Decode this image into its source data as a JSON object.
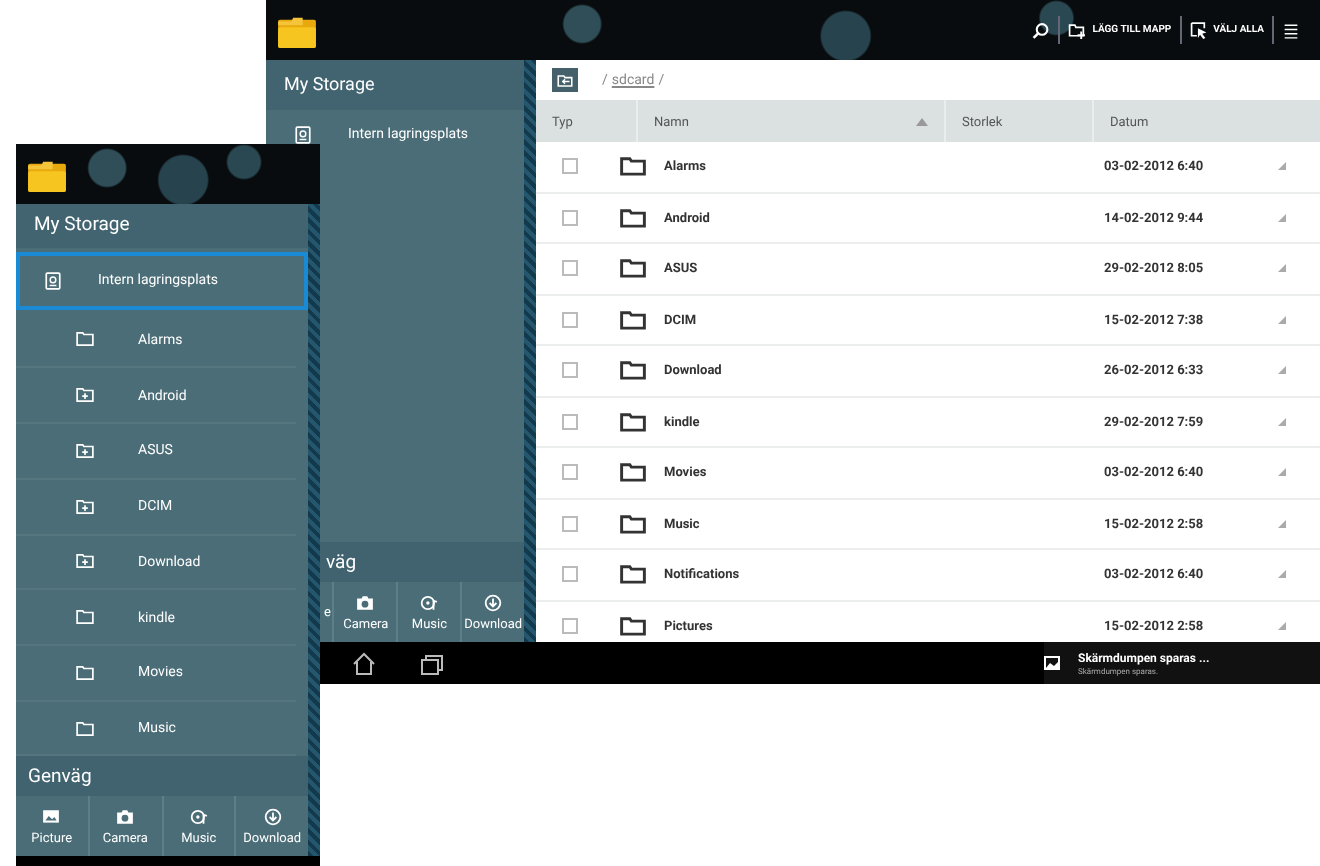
{
  "back_window": {
    "toolbar": {
      "actions": [
        {
          "kind": "search"
        },
        {
          "kind": "add_folder",
          "label": "LÄGG TILL MAPP"
        },
        {
          "kind": "select_all",
          "label": "VÄLJ ALLA"
        },
        {
          "kind": "menu"
        }
      ]
    },
    "sidebar": {
      "heading": "My Storage",
      "items": [
        {
          "label": "Intern lagringsplats",
          "selected": false
        }
      ],
      "shortcuts_heading": "väg",
      "shortcuts": [
        {
          "kind": "picture",
          "label": "e"
        },
        {
          "kind": "camera",
          "label": "Camera"
        },
        {
          "kind": "music",
          "label": "Music"
        },
        {
          "kind": "download",
          "label": "Download"
        }
      ]
    },
    "path": {
      "root": "/",
      "folder": "sdcard",
      "separator": "/"
    },
    "table": {
      "columns": [
        {
          "label": "Typ",
          "sorted": false
        },
        {
          "label": "Namn",
          "sorted": true
        },
        {
          "label": "Storlek",
          "sorted": false
        },
        {
          "label": "Datum",
          "sorted": false
        }
      ],
      "rows": [
        {
          "name": "Alarms",
          "date": "03-02-2012 6:40",
          "checked": false
        },
        {
          "name": "Android",
          "date": "14-02-2012 9:44",
          "checked": false
        },
        {
          "name": "ASUS",
          "date": "29-02-2012 8:05",
          "checked": false
        },
        {
          "name": "DCIM",
          "date": "15-02-2012 7:38",
          "checked": false
        },
        {
          "name": "Download",
          "date": "26-02-2012 6:33",
          "checked": false
        },
        {
          "name": "kindle",
          "date": "29-02-2012 7:59",
          "checked": false
        },
        {
          "name": "Movies",
          "date": "03-02-2012 6:40",
          "checked": false
        },
        {
          "name": "Music",
          "date": "15-02-2012 2:58",
          "checked": false
        },
        {
          "name": "Notifications",
          "date": "03-02-2012 6:40",
          "checked": false
        },
        {
          "name": "Pictures",
          "date": "15-02-2012 2:58",
          "checked": false
        }
      ]
    },
    "nav_bar": {
      "notification": {
        "title": "Skärmdumpen sparas ...",
        "text": "Skärmdumpen sparas."
      }
    }
  },
  "front_window": {
    "sidebar": {
      "heading": "My Storage",
      "items": [
        {
          "label": "Intern lagringsplats",
          "selected": true,
          "children": [
            {
              "label": "Alarms",
              "kind": "folder"
            },
            {
              "label": "Android",
              "kind": "folder_sub"
            },
            {
              "label": "ASUS",
              "kind": "folder_sub"
            },
            {
              "label": "DCIM",
              "kind": "folder_sub"
            },
            {
              "label": "Download",
              "kind": "folder_sub"
            },
            {
              "label": "kindle",
              "kind": "folder"
            },
            {
              "label": "Movies",
              "kind": "folder"
            },
            {
              "label": "Music",
              "kind": "folder"
            }
          ]
        }
      ],
      "shortcuts_heading": "Genväg",
      "shortcuts": [
        {
          "kind": "picture",
          "label": "Picture"
        },
        {
          "kind": "camera",
          "label": "Camera"
        },
        {
          "kind": "music",
          "label": "Music"
        },
        {
          "kind": "download",
          "label": "Download"
        }
      ]
    }
  }
}
